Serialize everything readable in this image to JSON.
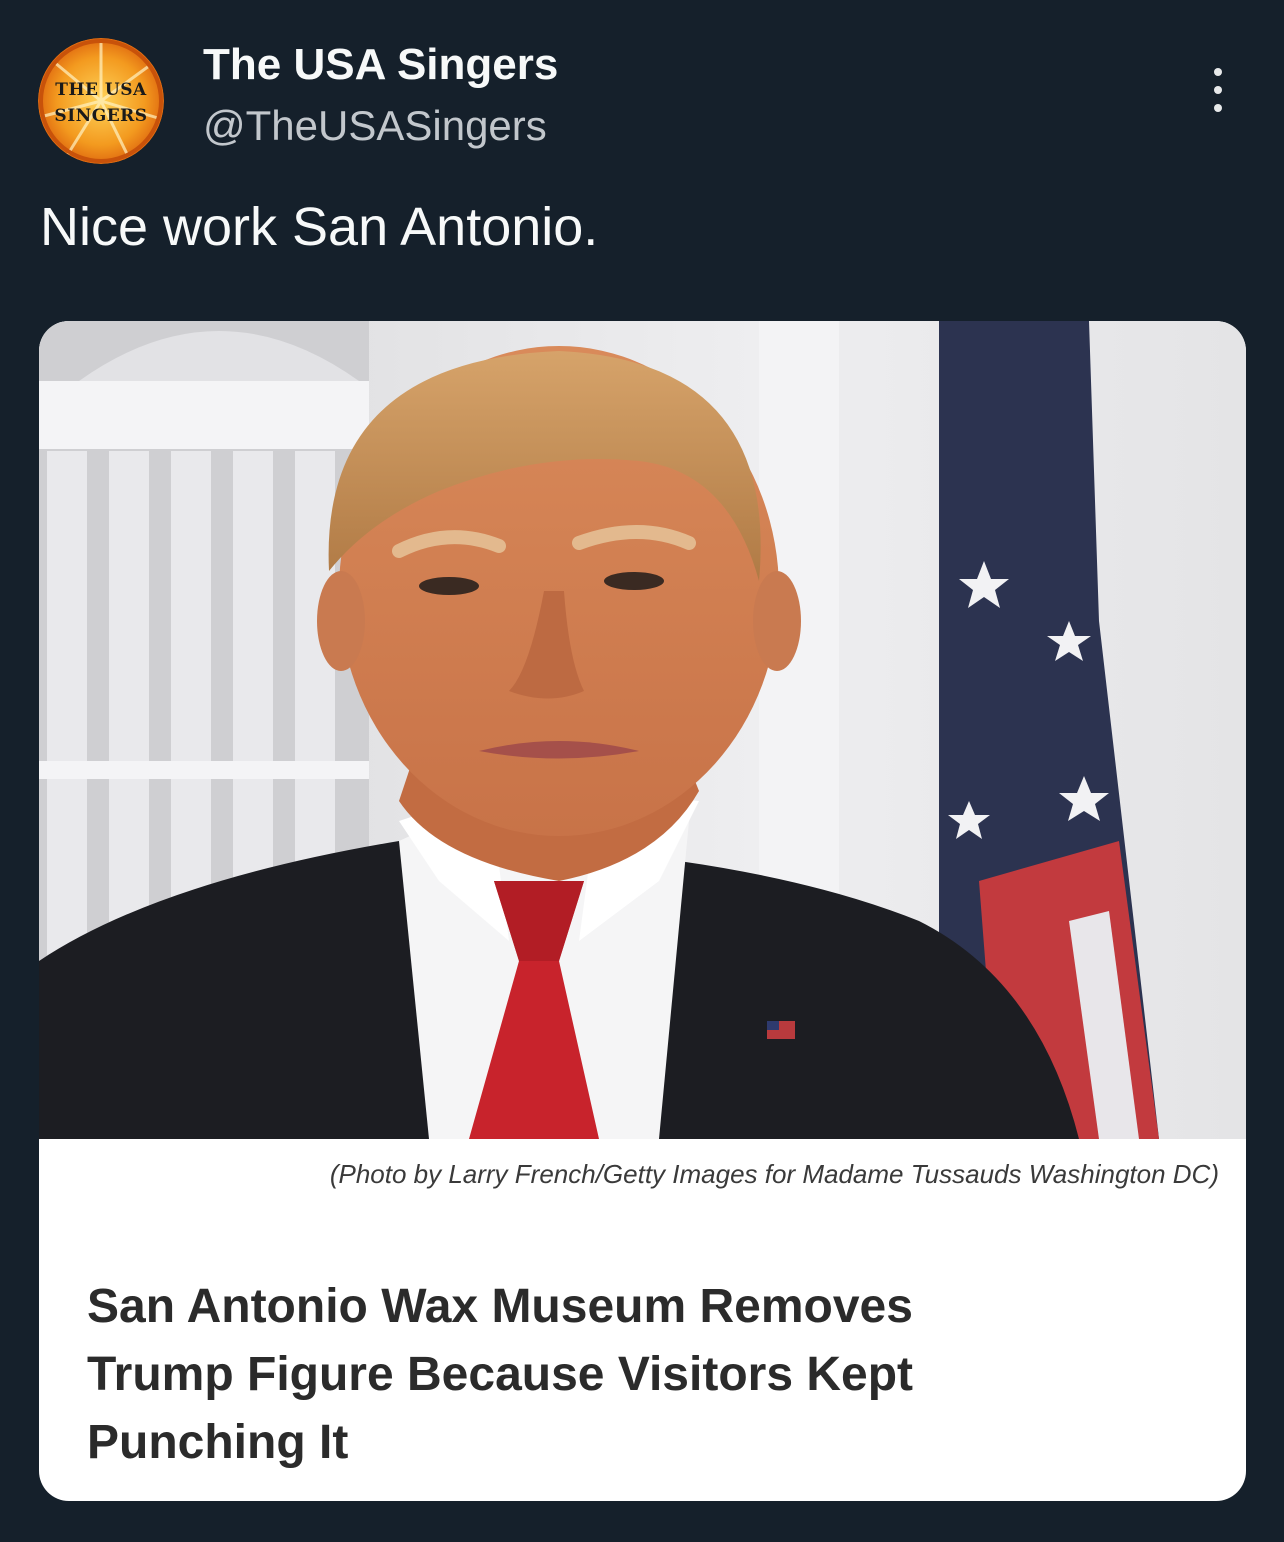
{
  "author": {
    "display_name": "The USA Singers",
    "handle": "@TheUSASingers",
    "avatar_text_line1": "THE USA",
    "avatar_text_line2": "SINGERS"
  },
  "tweet": {
    "text": "Nice work San Antonio."
  },
  "media": {
    "caption": "(Photo by Larry French/Getty Images for Madame Tussauds Washington DC)",
    "headline_lines": [
      "San Antonio Wax Museum Removes",
      "Trump Figure Because Visitors Kept",
      "Punching It"
    ]
  },
  "icons": {
    "more": "more-options-icon",
    "avatar": "orange-slice-avatar"
  },
  "colors": {
    "background": "#15202b",
    "name": "#f7f9f9",
    "handle": "#c2c7cc",
    "card": "#ffffff",
    "headline": "#2b2b2b",
    "tie": "#c8232c",
    "avatar_orange": "#f08a1c"
  }
}
